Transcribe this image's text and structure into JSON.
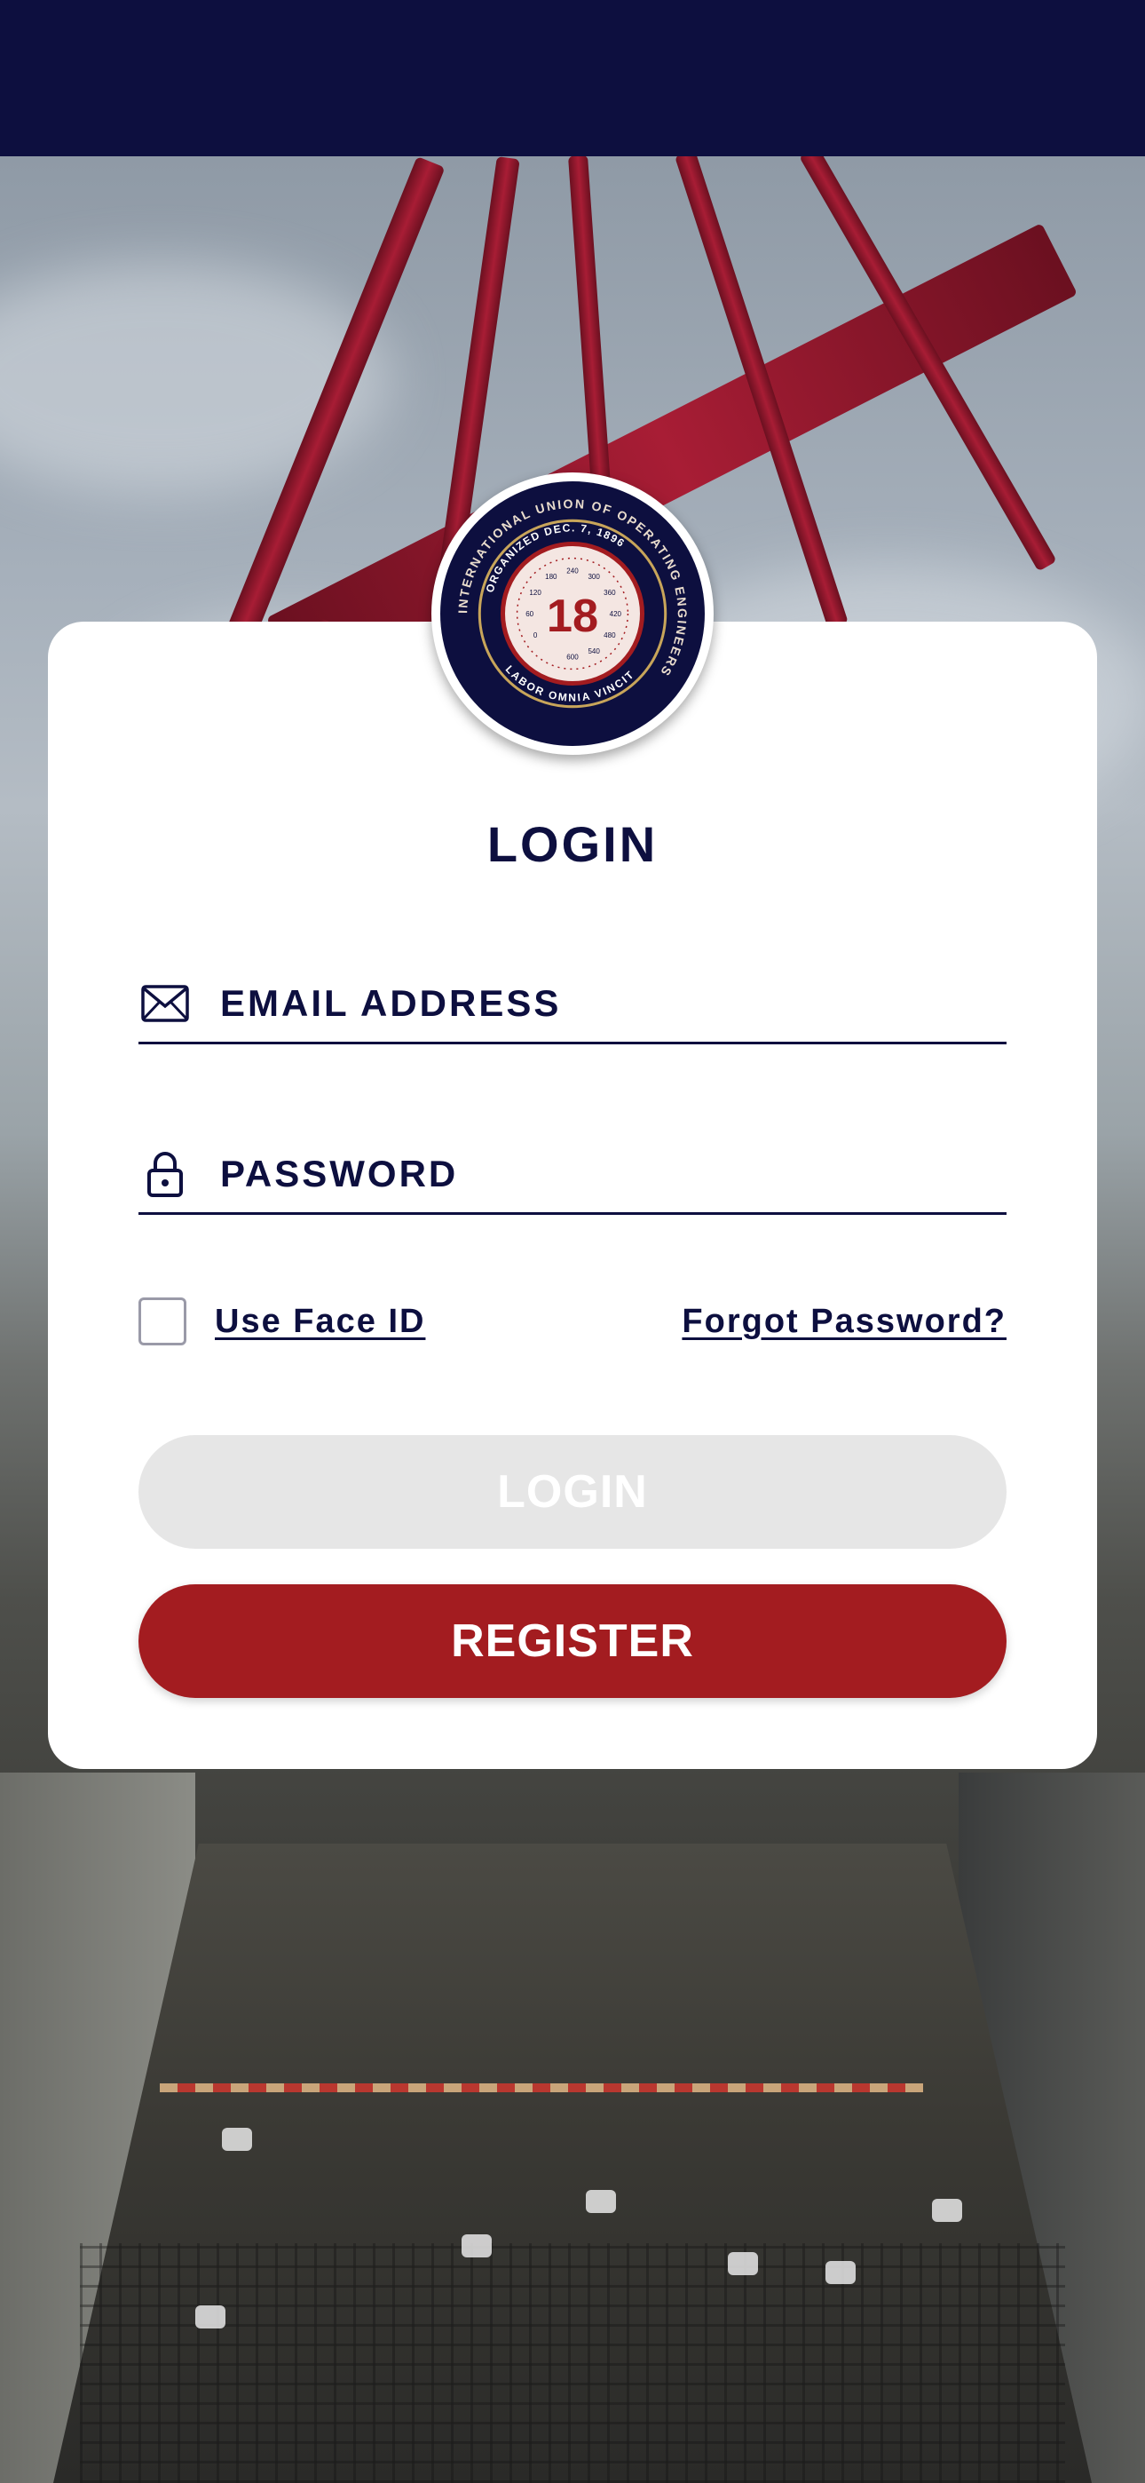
{
  "header": {
    "background": "#0d0f3f"
  },
  "logo": {
    "ring_text_top": "INTERNATIONAL UNION OF OPERATING ENGINEERS",
    "ring_text_inner": "ORGANIZED DEC. 7, 1896",
    "motto": "LABOR OMNIA VINCIT",
    "number": "18",
    "gauge_ticks": [
      "0",
      "60",
      "120",
      "180",
      "240",
      "300",
      "360",
      "420",
      "480",
      "540",
      "600"
    ]
  },
  "login_form": {
    "title": "LOGIN",
    "email": {
      "icon": "envelope-icon",
      "placeholder": "EMAIL ADDRESS",
      "value": ""
    },
    "password": {
      "icon": "lock-icon",
      "placeholder": "PASSWORD",
      "value": ""
    },
    "face_id": {
      "label": "Use Face ID",
      "checked": false
    },
    "forgot_password": "Forgot Password?",
    "login_button": "LOGIN",
    "register_button": "REGISTER"
  },
  "colors": {
    "navy": "#0d0f3f",
    "red": "#a31c20",
    "disabled_button": "#e6e6e6"
  }
}
